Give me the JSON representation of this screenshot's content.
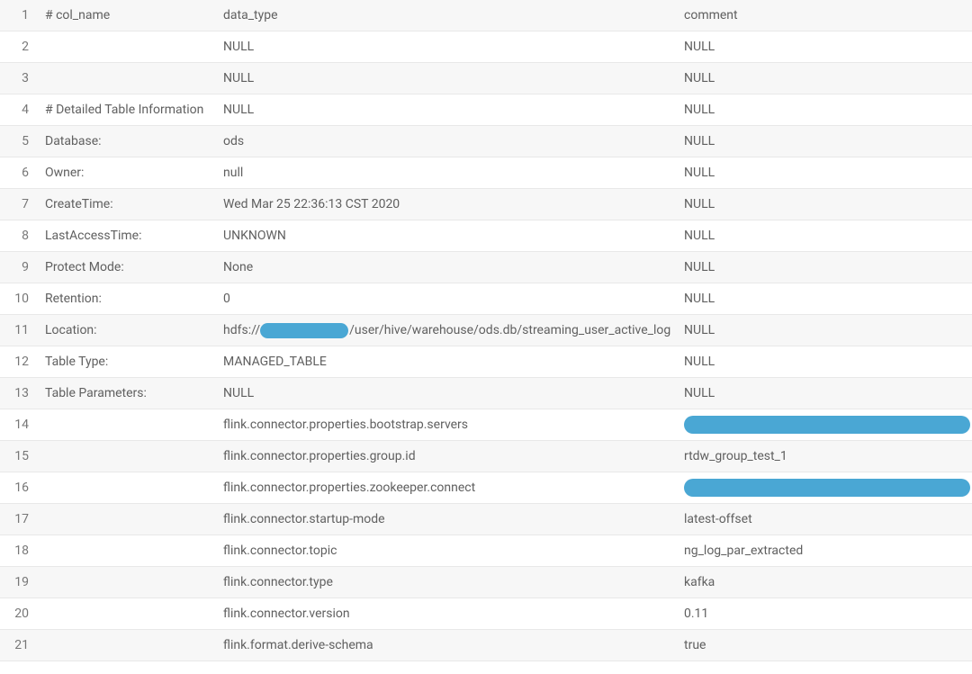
{
  "columns": {
    "col1_header": "# col_name",
    "col2_header": "data_type",
    "col3_header": "comment"
  },
  "rows": [
    {
      "index": "1",
      "name": "# col_name",
      "type": "data_type",
      "comment": "comment",
      "redactedType": false,
      "redactedComment": false
    },
    {
      "index": "2",
      "name": "",
      "type": "NULL",
      "comment": "NULL",
      "redactedType": false,
      "redactedComment": false
    },
    {
      "index": "3",
      "name": "",
      "type": "NULL",
      "comment": "NULL",
      "redactedType": false,
      "redactedComment": false
    },
    {
      "index": "4",
      "name": "# Detailed Table Information",
      "type": "NULL",
      "comment": "NULL",
      "redactedType": false,
      "redactedComment": false
    },
    {
      "index": "5",
      "name": "Database:",
      "type": "ods",
      "comment": "NULL",
      "redactedType": false,
      "redactedComment": false
    },
    {
      "index": "6",
      "name": "Owner:",
      "type": "null",
      "comment": "NULL",
      "redactedType": false,
      "redactedComment": false
    },
    {
      "index": "7",
      "name": "CreateTime:",
      "type": "Wed Mar 25 22:36:13 CST 2020",
      "comment": "NULL",
      "redactedType": false,
      "redactedComment": false
    },
    {
      "index": "8",
      "name": "LastAccessTime:",
      "type": "UNKNOWN",
      "comment": "NULL",
      "redactedType": false,
      "redactedComment": false
    },
    {
      "index": "9",
      "name": "Protect Mode:",
      "type": "None",
      "comment": "NULL",
      "redactedType": false,
      "redactedComment": false
    },
    {
      "index": "10",
      "name": "Retention:",
      "type": "0",
      "comment": "NULL",
      "redactedType": false,
      "redactedComment": false
    },
    {
      "index": "11",
      "name": "Location:",
      "type_prefix": "hdfs://",
      "type_suffix": "/user/hive/warehouse/ods.db/streaming_user_active_log",
      "comment": "NULL",
      "redactedType": "inline",
      "redactedComment": false
    },
    {
      "index": "12",
      "name": "Table Type:",
      "type": "MANAGED_TABLE",
      "comment": "NULL",
      "redactedType": false,
      "redactedComment": false
    },
    {
      "index": "13",
      "name": "Table Parameters:",
      "type": "NULL",
      "comment": "NULL",
      "redactedType": false,
      "redactedComment": false
    },
    {
      "index": "14",
      "name": "",
      "type": "flink.connector.properties.bootstrap.servers",
      "comment": "",
      "redactedType": false,
      "redactedComment": true
    },
    {
      "index": "15",
      "name": "",
      "type": "flink.connector.properties.group.id",
      "comment": "rtdw_group_test_1",
      "redactedType": false,
      "redactedComment": false
    },
    {
      "index": "16",
      "name": "",
      "type": "flink.connector.properties.zookeeper.connect",
      "comment": "",
      "redactedType": false,
      "redactedComment": true
    },
    {
      "index": "17",
      "name": "",
      "type": "flink.connector.startup-mode",
      "comment": "latest-offset",
      "redactedType": false,
      "redactedComment": false
    },
    {
      "index": "18",
      "name": "",
      "type": "flink.connector.topic",
      "comment": "ng_log_par_extracted",
      "redactedType": false,
      "redactedComment": false
    },
    {
      "index": "19",
      "name": "",
      "type": "flink.connector.type",
      "comment": "kafka",
      "redactedType": false,
      "redactedComment": false
    },
    {
      "index": "20",
      "name": "",
      "type": "flink.connector.version",
      "comment": "0.11",
      "redactedType": false,
      "redactedComment": false
    },
    {
      "index": "21",
      "name": "",
      "type": "flink.format.derive-schema",
      "comment": "true",
      "redactedType": false,
      "redactedComment": false
    }
  ]
}
